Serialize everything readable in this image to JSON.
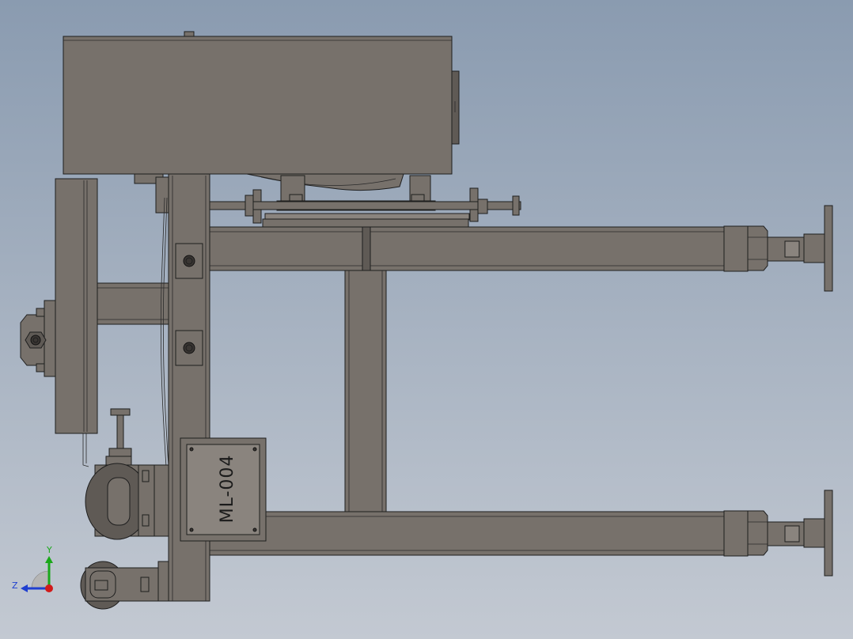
{
  "model": {
    "part_label": "ML-004"
  },
  "triad": {
    "y_label": "Y",
    "z_label": "Z",
    "y_color": "#1aa81a",
    "z_color": "#1f3fd0",
    "x_color": "#d11a1a"
  },
  "colors": {
    "background_top": "#8a9bb0",
    "background_bottom": "#c3c9d2",
    "metal": "#77716b"
  }
}
